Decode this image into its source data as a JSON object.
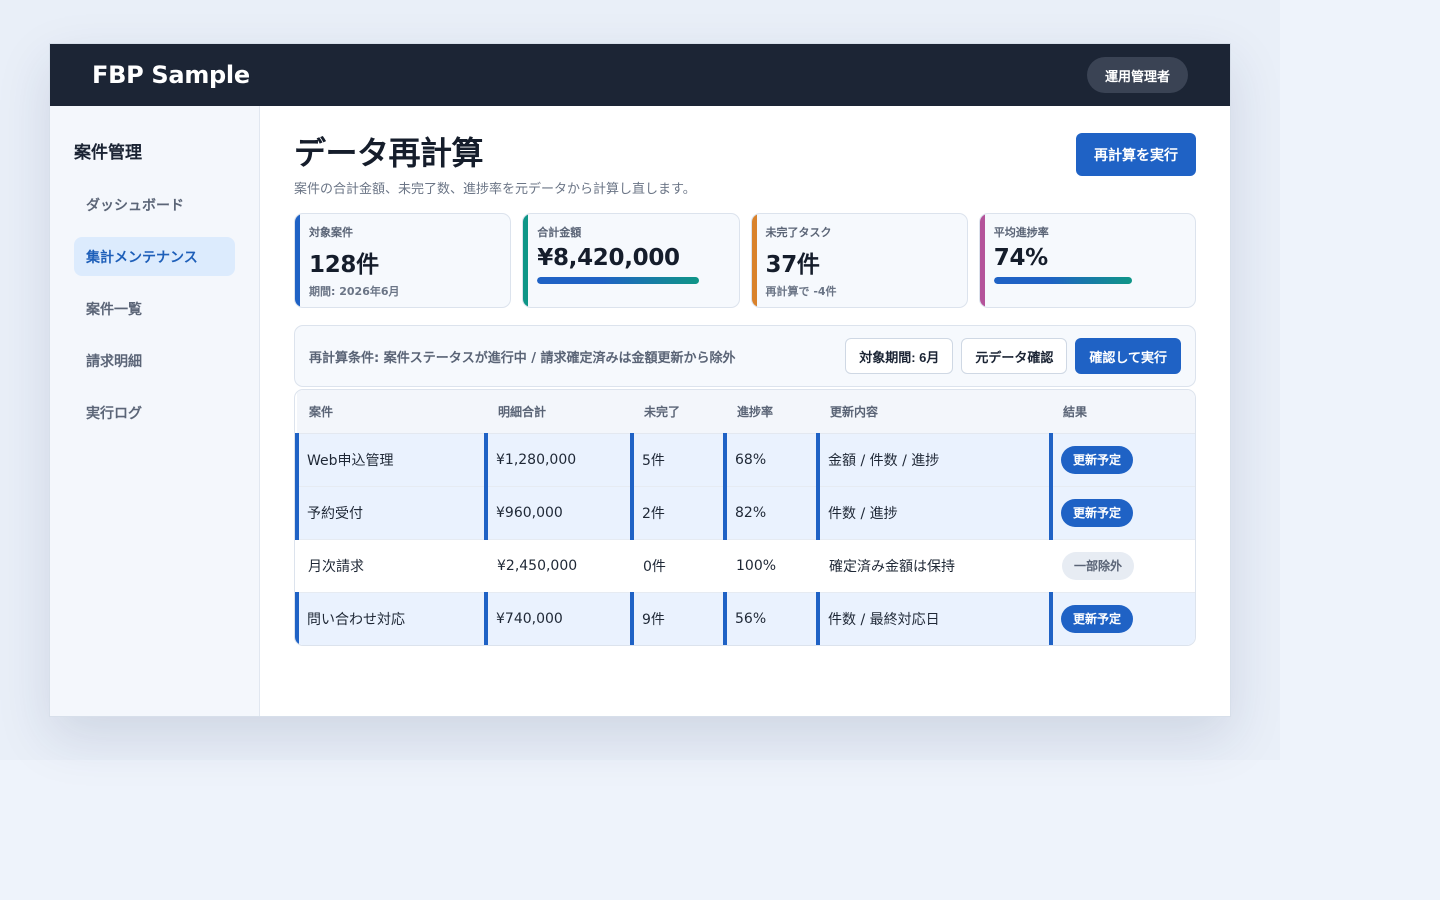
{
  "app": {
    "brand": "FBP Sample",
    "role": "運用管理者"
  },
  "sidebar": {
    "title": "案件管理",
    "items": [
      {
        "label": "ダッシュボード",
        "active": false
      },
      {
        "label": "集計メンテナンス",
        "active": true
      },
      {
        "label": "案件一覧",
        "active": false
      },
      {
        "label": "請求明細",
        "active": false
      },
      {
        "label": "実行ログ",
        "active": false
      }
    ]
  },
  "page": {
    "title": "データ再計算",
    "subtitle": "案件の合計金額、未完了数、進捗率を元データから計算し直します。",
    "run_button": "再計算を実行"
  },
  "stats": [
    {
      "label": "対象案件",
      "value": "128件",
      "note": "期間: 2026年6月",
      "accent": "#1f62c5"
    },
    {
      "label": "合計金額",
      "value": "¥8,420,000",
      "progress": 0.77,
      "accent": "#0f9687"
    },
    {
      "label": "未完了タスク",
      "value": "37件",
      "note": "再計算で -4件",
      "accent": "#d9822b"
    },
    {
      "label": "平均進捗率",
      "value": "74%",
      "progress": 0.66,
      "accent": "#b4539a"
    }
  ],
  "conditions": {
    "text": "再計算条件: 案件ステータスが進行中 / 請求確定済みは金額更新から除外",
    "period_button": "対象期間: 6月",
    "source_button": "元データ確認",
    "confirm_button": "確認して実行"
  },
  "table": {
    "columns": [
      "案件",
      "明細合計",
      "未完了",
      "進捗率",
      "更新内容",
      "結果"
    ],
    "rows": [
      {
        "cells": [
          "Web申込管理",
          "¥1,280,000",
          "5件",
          "68%",
          "金額 / 件数 / 進捗"
        ],
        "result": "更新予定",
        "status": "update"
      },
      {
        "cells": [
          "予約受付",
          "¥960,000",
          "2件",
          "82%",
          "件数 / 進捗"
        ],
        "result": "更新予定",
        "status": "update"
      },
      {
        "cells": [
          "月次請求",
          "¥2,450,000",
          "0件",
          "100%",
          "確定済み金額は保持"
        ],
        "result": "一部除外",
        "status": "exclude"
      },
      {
        "cells": [
          "問い合わせ対応",
          "¥740,000",
          "9件",
          "56%",
          "件数 / 最終対応日"
        ],
        "result": "更新予定",
        "status": "update"
      }
    ]
  },
  "colors": {
    "topbar": "#1c2535",
    "primary": "#1f62c5",
    "teal": "#0f9687",
    "orange": "#d9822b",
    "magenta": "#b4539a"
  }
}
